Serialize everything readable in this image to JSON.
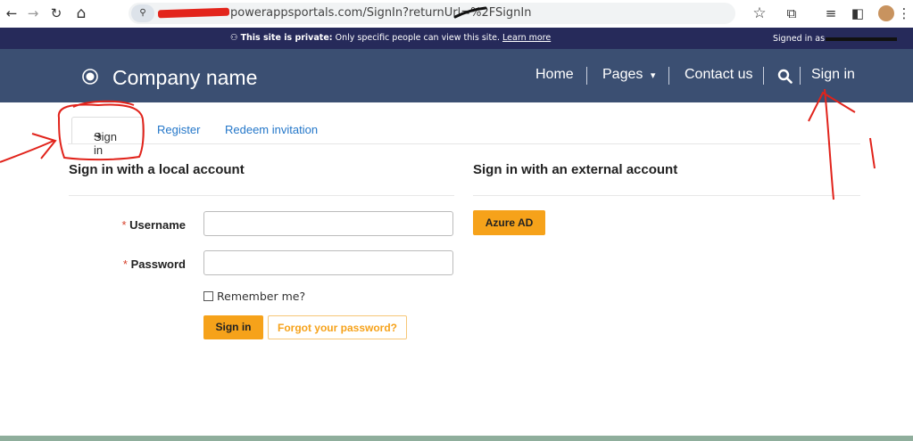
{
  "browser": {
    "url": "powerappsportals.com/SignIn?returnUrl=%2FSignIn",
    "icons": [
      "back-arrow-icon",
      "forward-arrow-icon",
      "reload-icon",
      "home-icon",
      "site-info-icon",
      "bookmark-star-icon",
      "extensions-icon",
      "tab-search-icon",
      "side-panel-icon",
      "profile-avatar",
      "more-menu-icon"
    ],
    "glyphs": {
      "back": "←",
      "forward": "→",
      "reload": "↻",
      "home": "⌂",
      "site_info": "⚲",
      "star": "☆",
      "ext": "⧉",
      "tabsearch": "≡",
      "panel": "◧",
      "more": "⋮"
    }
  },
  "notice": {
    "lock_icon": "⚇",
    "bold": "This site is private:",
    "text": " Only specific people can view this site. ",
    "link": "Learn more",
    "signed_in_as": "Signed in as"
  },
  "header": {
    "company": "Company name",
    "nav": {
      "home": "Home",
      "pages": "Pages",
      "pages_caret": "▾",
      "contact": "Contact us",
      "search_icon": "🔍",
      "signin": "Sign in"
    }
  },
  "tabs": {
    "signin_glyph": "➔",
    "signin": "Sign in",
    "register": "Register",
    "redeem": "Redeem invitation"
  },
  "local": {
    "title": "Sign in with a local account",
    "username_label": "Username",
    "password_label": "Password",
    "required_mark": "*",
    "username_value": "",
    "password_value": "",
    "remember": "Remember me?",
    "signin_button": "Sign in",
    "forgot_button": "Forgot your password?"
  },
  "external": {
    "title": "Sign in with an external account",
    "azure_button": "Azure AD"
  },
  "colors": {
    "notice_bg": "#262a5a",
    "header_bg": "#3b4f72",
    "accent": "#f6a21a",
    "link": "#2477c9",
    "annotation": "#e1231b"
  }
}
